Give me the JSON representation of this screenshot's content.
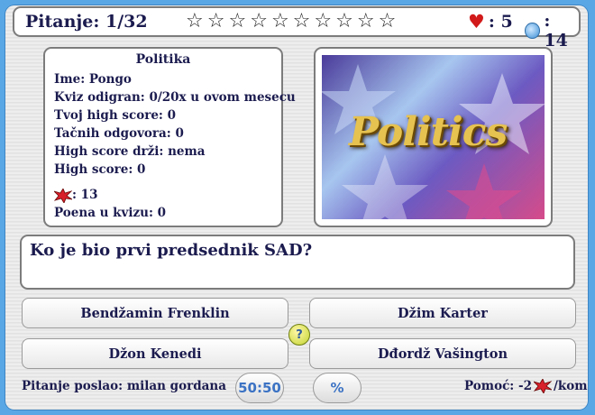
{
  "header": {
    "question_counter": "Pitanje: 1/32",
    "stars": [
      "☆",
      "☆",
      "☆",
      "☆",
      "☆",
      "☆",
      "☆",
      "☆",
      "☆",
      "☆"
    ],
    "lives_value": ": 5",
    "timer_value": ": 14"
  },
  "info": {
    "category": "Politika",
    "rows": [
      "Ime: Pongo",
      "Kviz odigran: 0/20x u ovom mesecu",
      "Tvoj high score: 0",
      "Tačnih odgovora: 0",
      "High score drži: nema",
      "High score: 0"
    ],
    "burst_value": ": 13",
    "points": "Poena u kvizu: 0"
  },
  "image": {
    "text": "Politics"
  },
  "question": "Ko je bio prvi predsednik SAD?",
  "answers": [
    "Bendžamin Frenklin",
    "Džim Karter",
    "Džon Kenedi",
    "Dđordž Vašington"
  ],
  "footer": {
    "sender": "Pitanje poslao: milan gordana",
    "btn_5050": "50:50",
    "btn_percent": "%",
    "help_label": "Pomoć: -2",
    "help_suffix": "/kom"
  },
  "colors": {
    "background": "#5aa7e6",
    "text": "#1b1b4f",
    "accent": "#3c73c4"
  },
  "icons": {
    "lives": "heart-icon",
    "timer": "clock-icon",
    "help": "help-icon",
    "burst": "burst-icon"
  }
}
